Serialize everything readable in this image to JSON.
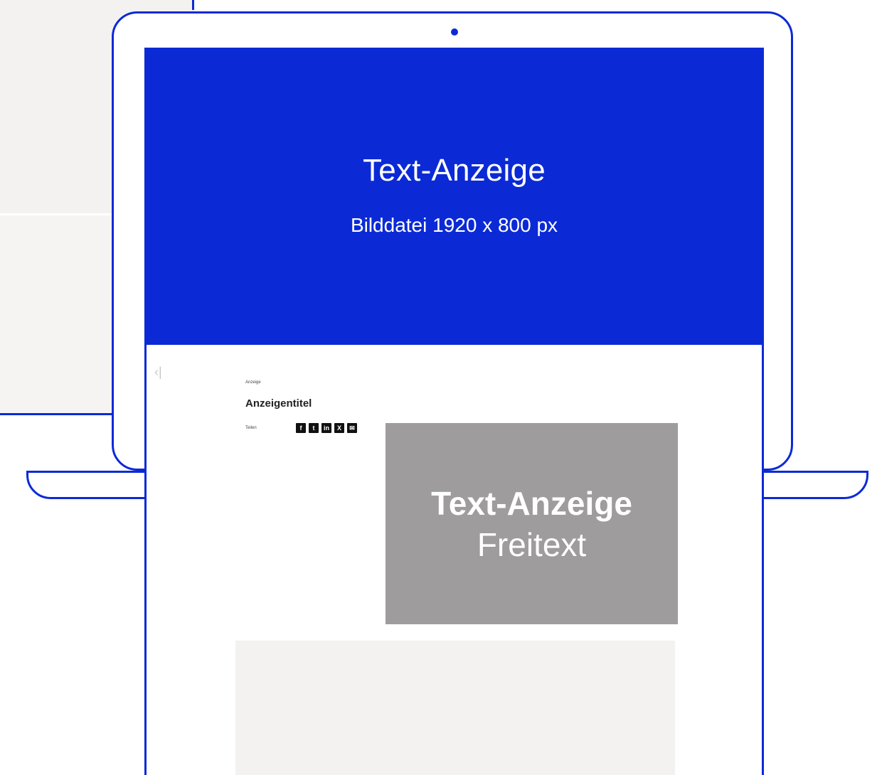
{
  "hero": {
    "title": "Text-Anzeige",
    "subtitle": "Bilddatei 1920 x 800 px"
  },
  "preview": {
    "eyebrow": "Anzeige",
    "title": "Anzeigentitel",
    "share_label": "Teilen",
    "share_icons": [
      {
        "name": "facebook-icon",
        "glyph": "f"
      },
      {
        "name": "twitter-icon",
        "glyph": "t"
      },
      {
        "name": "linkedin-icon",
        "glyph": "in"
      },
      {
        "name": "xing-icon",
        "glyph": "X"
      },
      {
        "name": "email-icon",
        "glyph": "✉"
      }
    ],
    "image_title": "Text-Anzeige",
    "image_subtitle": "Freitext"
  },
  "colors": {
    "accent": "#0b2ad6",
    "image_placeholder": "#9e9c9d",
    "panel_bg": "#f3f2f0"
  }
}
